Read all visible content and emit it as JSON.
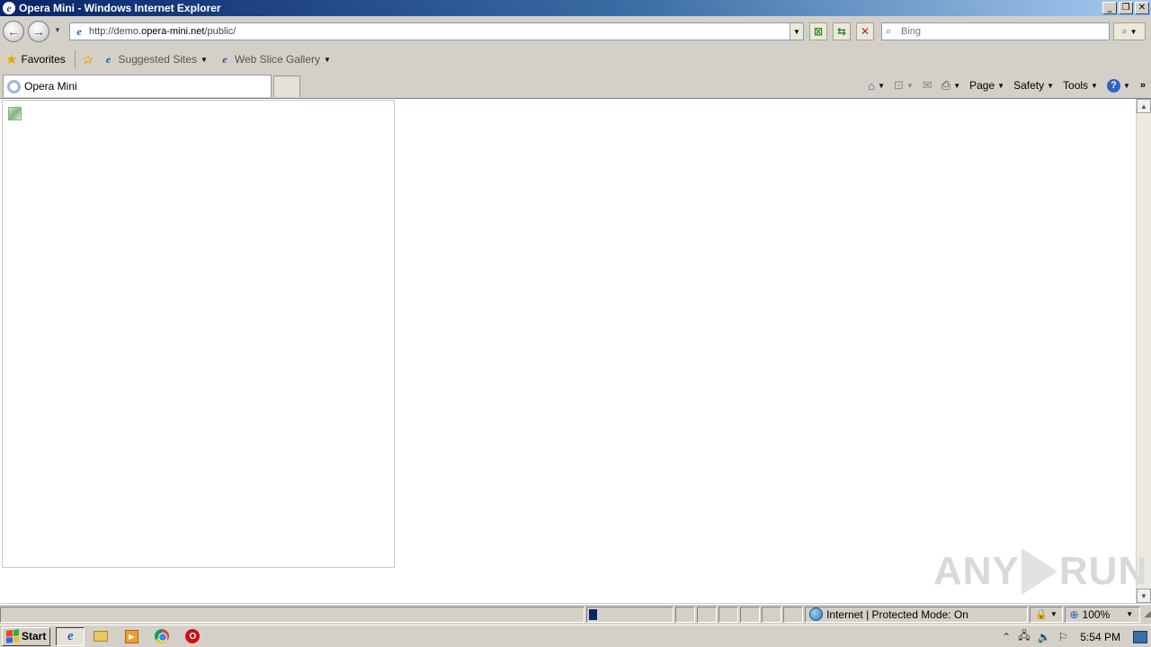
{
  "window": {
    "title": "Opera Mini - Windows Internet Explorer",
    "controls": {
      "minimize": "_",
      "restore": "❐",
      "close": "✕"
    }
  },
  "address_bar": {
    "url_prefix": "http://demo.",
    "url_domain": "opera-mini.net",
    "url_suffix": "/public/",
    "search_placeholder": "Bing"
  },
  "favorites_bar": {
    "favorites_label": "Favorites",
    "links": [
      {
        "label": "Suggested Sites"
      },
      {
        "label": "Web Slice Gallery"
      }
    ]
  },
  "tabs": [
    {
      "label": "Opera Mini",
      "active": true
    }
  ],
  "command_bar": {
    "page_label": "Page",
    "safety_label": "Safety",
    "tools_label": "Tools"
  },
  "status_bar": {
    "zone_text": "Internet | Protected Mode: On",
    "zoom": "100%",
    "progress": 0.1
  },
  "watermark": {
    "left_text": "ANY",
    "right_text": "RUN"
  },
  "taskbar": {
    "start_label": "Start",
    "time": "5:54 PM"
  },
  "colors": {
    "title_gradient_start": "#0a246a",
    "chrome": "#d4d0c8",
    "progress_fill": "#0a246a"
  }
}
